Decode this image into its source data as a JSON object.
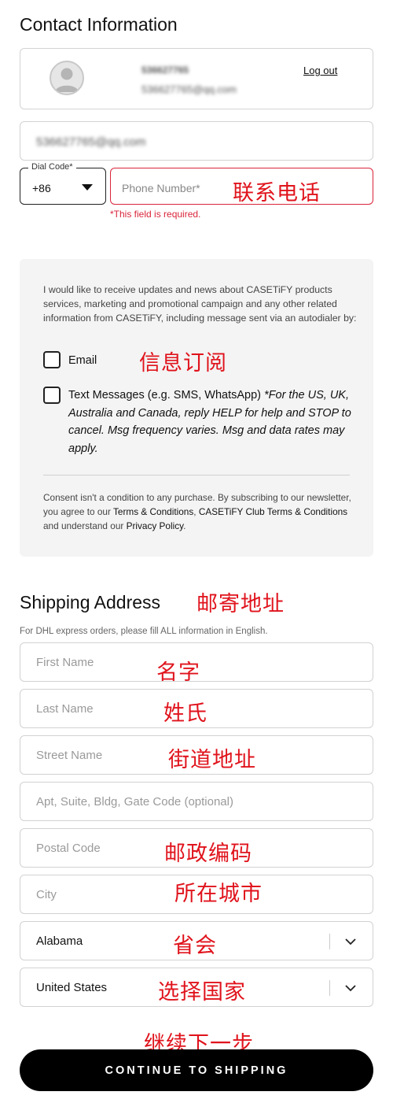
{
  "contact": {
    "title": "Contact Information",
    "account_id": "536627765",
    "account_email": "536627765@qq.com",
    "logout": "Log out",
    "email_field_value": "536627765@qq.com",
    "dial_code_label": "Dial Code*",
    "dial_code_value": "+86",
    "phone_placeholder": "Phone Number*",
    "phone_annotation": "联系电话",
    "phone_error": "*This field is required."
  },
  "subscribe": {
    "intro": "I would like to receive updates and news about CASETiFY products services, marketing and promotional campaign and any other related information from CASETiFY, including message sent via an autodialer by:",
    "email_label": "Email",
    "annotation": "信息订阅",
    "sms_label": "Text Messages (e.g. SMS, WhatsApp)",
    "sms_note": "*For the US, UK, Australia and Canada, reply HELP for help and STOP to cancel. Msg frequency varies. Msg and data rates may apply.",
    "consent_1": "Consent isn't a condition to any purchase. By subscribing to our newsletter, you agree to our ",
    "consent_link_1": "Terms & Conditions",
    "consent_2": ", ",
    "consent_link_2": "CASETiFY Club Terms & Conditions",
    "consent_3": " and understand our ",
    "consent_link_3": "Privacy Policy",
    "consent_4": "."
  },
  "shipping": {
    "title": "Shipping Address",
    "title_annotation": "邮寄地址",
    "note": "For DHL express orders, please fill ALL information in English.",
    "fields": [
      {
        "placeholder": "First Name",
        "annotation": "名字"
      },
      {
        "placeholder": "Last Name",
        "annotation": "姓氏"
      },
      {
        "placeholder": "Street Name",
        "annotation": "街道地址"
      },
      {
        "placeholder": "Apt, Suite, Bldg, Gate Code (optional)",
        "annotation": ""
      },
      {
        "placeholder": "Postal Code",
        "annotation": "邮政编码"
      },
      {
        "placeholder": "City",
        "annotation": "所在城市"
      }
    ],
    "state_value": "Alabama",
    "state_annotation": "省会",
    "country_value": "United States",
    "country_annotation": "选择国家"
  },
  "footer": {
    "annotation": "继续下一步",
    "button": "CONTINUE TO SHIPPING"
  }
}
